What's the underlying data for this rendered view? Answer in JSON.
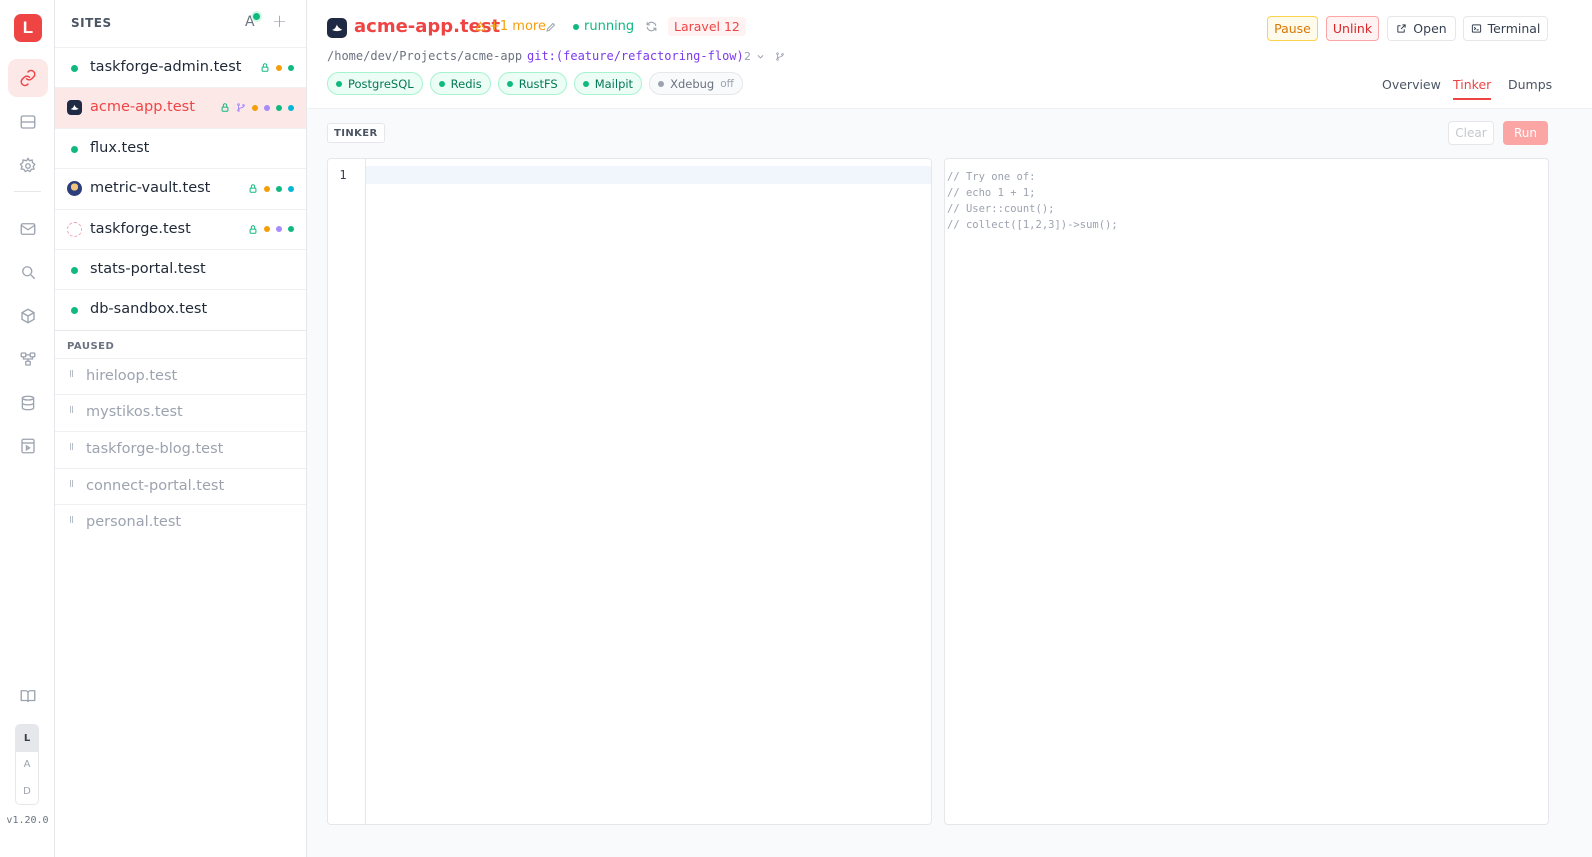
{
  "app": {
    "logo_letter": "L",
    "version": "v1.20.0"
  },
  "rail": {
    "items": [
      "link-icon",
      "server-icon",
      "gear-icon",
      "mail-icon",
      "search-icon",
      "cube-icon",
      "network-icon",
      "database-icon",
      "inspect-icon"
    ],
    "bottom": [
      "book-icon"
    ],
    "theme": [
      "L",
      "A",
      "D"
    ],
    "theme_active": "L"
  },
  "sites": {
    "heading": "SITES",
    "ai_label": "A",
    "add_label": "+",
    "running": [
      {
        "name": "taskforge-admin.test",
        "favicon": null,
        "lock": true,
        "branch": false,
        "dots": [
          "#f59e0b",
          "#10b981"
        ]
      },
      {
        "name": "acme-app.test",
        "favicon": "laravel-boat",
        "lock": true,
        "branch": true,
        "dots": [
          "#f59e0b",
          "#a78bfa",
          "#10b981",
          "#06b6d4"
        ]
      },
      {
        "name": "flux.test",
        "favicon": null,
        "lock": false,
        "branch": false,
        "dots": []
      },
      {
        "name": "metric-vault.test",
        "favicon": "astronaut",
        "lock": true,
        "branch": false,
        "dots": [
          "#f59e0b",
          "#10b981",
          "#06b6d4"
        ]
      },
      {
        "name": "taskforge.test",
        "favicon": "swirl",
        "lock": true,
        "branch": false,
        "dots": [
          "#f59e0b",
          "#a78bfa",
          "#10b981"
        ]
      },
      {
        "name": "stats-portal.test",
        "favicon": null,
        "lock": false,
        "branch": false,
        "dots": []
      },
      {
        "name": "db-sandbox.test",
        "favicon": null,
        "lock": false,
        "branch": false,
        "dots": []
      }
    ],
    "paused_heading": "PAUSED",
    "paused": [
      "hireloop.test",
      "mystikos.test",
      "taskforge-blog.test",
      "connect-portal.test",
      "personal.test"
    ],
    "pause_glyph": "II"
  },
  "header": {
    "title": "acme-app.test",
    "more": "+1 more",
    "status": "running",
    "framework": "Laravel 12",
    "path": "/home/dev/Projects/acme-app",
    "git": "git:(feature/refactoring-flow)",
    "ahead": "2",
    "services": [
      {
        "name": "PostgreSQL",
        "on": true
      },
      {
        "name": "Redis",
        "on": true
      },
      {
        "name": "RustFS",
        "on": true
      },
      {
        "name": "Mailpit",
        "on": true
      },
      {
        "name": "Xdebug",
        "on": false,
        "state": "off"
      }
    ],
    "actions": {
      "pause": "Pause",
      "unlink": "Unlink",
      "open": "Open",
      "terminal": "Terminal"
    },
    "tabs": [
      "Overview",
      "Tinker",
      "Dumps"
    ],
    "active_tab": "Tinker"
  },
  "tinker": {
    "label": "TINKER",
    "clear": "Clear",
    "run": "Run",
    "line_number": "1",
    "code": "",
    "output_hint": [
      "// Try one of:",
      "// echo 1 + 1;",
      "// User::count();",
      "// collect([1,2,3])->sum();"
    ]
  },
  "colors": {
    "accent": "#ef4444",
    "running": "#10b981",
    "warning": "#f59e0b",
    "git": "#7c3aed"
  }
}
